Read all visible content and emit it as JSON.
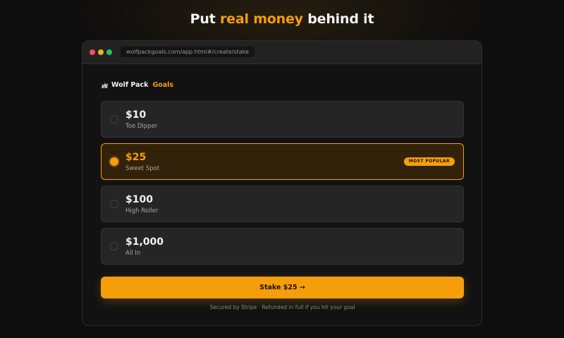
{
  "headline": {
    "prefix": "Put ",
    "accent": "real money",
    "suffix": " behind it"
  },
  "browser": {
    "url": "wolfpackgoals.com/app.html#/create/stake"
  },
  "brand": {
    "icon": "wolf-icon",
    "name": "Wolf Pack",
    "accent": "Goals"
  },
  "options": [
    {
      "amount": "$10",
      "label": "Toe Dipper",
      "selected": false
    },
    {
      "amount": "$25",
      "label": "Sweet Spot",
      "selected": true,
      "badge": "MOST POPULAR"
    },
    {
      "amount": "$100",
      "label": "High Roller",
      "selected": false
    },
    {
      "amount": "$1,000",
      "label": "All In",
      "selected": false
    }
  ],
  "cta": {
    "label": "Stake $25 →"
  },
  "footnote": "Secured by Stripe · Refunded in full if you hit your goal",
  "colors": {
    "accent": "#f59e0b",
    "background": "#0e0e0e",
    "card": "#252525"
  }
}
